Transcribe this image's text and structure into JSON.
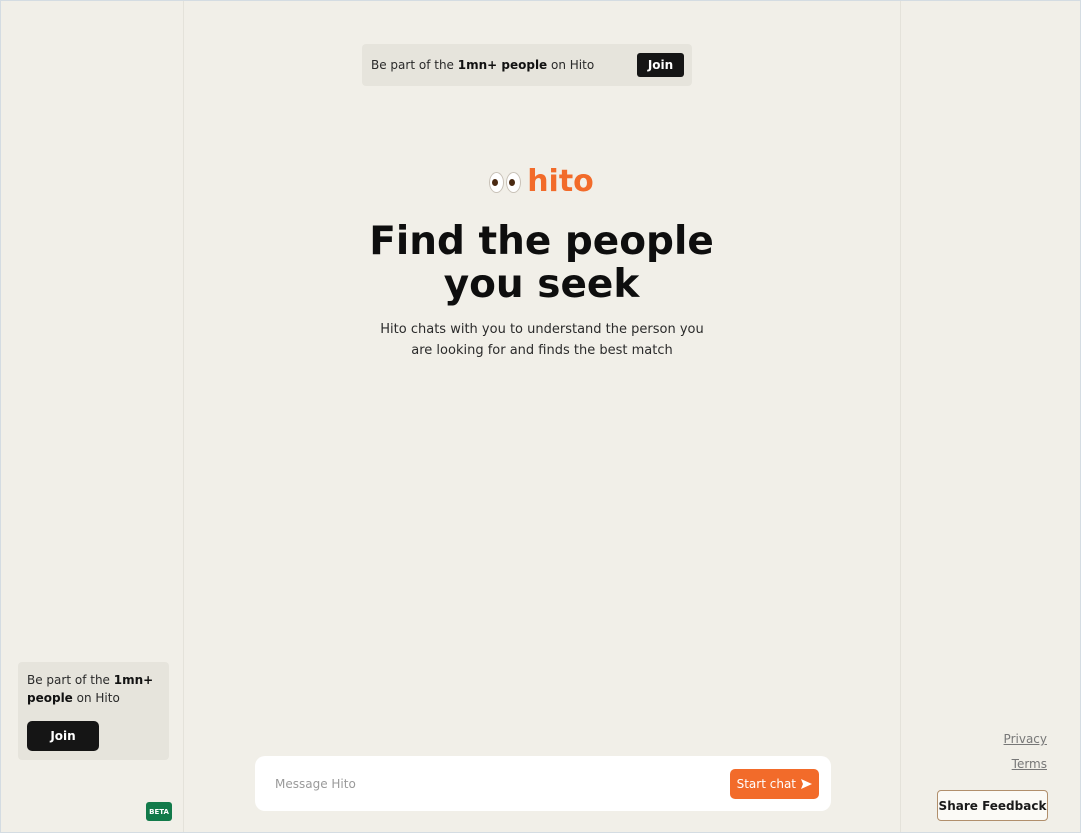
{
  "banner": {
    "prefix": "Be part of the ",
    "bold": "1mn+ people",
    "suffix": " on Hito",
    "join_label": "Join"
  },
  "logo": {
    "icon": "eyes-icon",
    "text": "hito",
    "color": "#f26b2a"
  },
  "hero": {
    "title_line1": "Find the people",
    "title_line2": "you seek",
    "subtitle": "Hito chats with you to understand the person you are looking for and finds the best match"
  },
  "side_card": {
    "prefix": "Be part of the ",
    "bold_1": "1mn+",
    "bold_2": "people",
    "suffix": " on Hito",
    "join_label": "Join"
  },
  "badge": {
    "label": "BETA",
    "color": "#127a4a"
  },
  "chat": {
    "placeholder": "Message Hito",
    "start_label": "Start chat",
    "send_icon": "send-icon"
  },
  "footer": {
    "privacy": "Privacy",
    "terms": "Terms",
    "feedback": "Share Feedback"
  }
}
